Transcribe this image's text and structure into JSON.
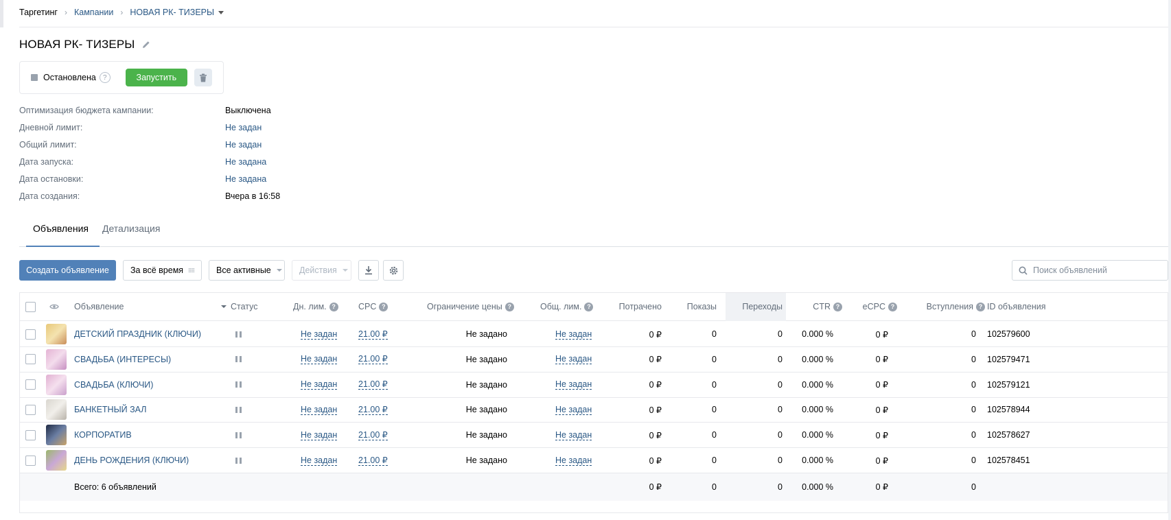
{
  "breadcrumb": {
    "items": [
      "Таргетинг",
      "Кампании",
      "НОВАЯ РК- ТИЗЕРЫ"
    ],
    "separator": "›"
  },
  "campaign": {
    "title": "НОВАЯ РК- ТИЗЕРЫ",
    "status": "Остановлена",
    "help": "?",
    "start_label": "Запустить"
  },
  "info": [
    {
      "label": "Оптимизация бюджета кампании:",
      "value": "Выключена",
      "link": false
    },
    {
      "label": "Дневной лимит:",
      "value": "Не задан",
      "link": true
    },
    {
      "label": "Общий лимит:",
      "value": "Не задан",
      "link": true
    },
    {
      "label": "Дата запуска:",
      "value": "Не задана",
      "link": true
    },
    {
      "label": "Дата остановки:",
      "value": "Не задана",
      "link": true
    },
    {
      "label": "Дата создания:",
      "value": "Вчера в 16:58",
      "link": false
    }
  ],
  "tabs": [
    {
      "label": "Объявления",
      "active": true
    },
    {
      "label": "Детализация",
      "active": false
    }
  ],
  "toolbar": {
    "create_label": "Создать объявление",
    "period_label": "За всё время",
    "filter_label": "Все активные",
    "actions_label": "Действия",
    "search_placeholder": "Поиск объявлений"
  },
  "table": {
    "headers": {
      "ad": "Объявление",
      "status": "Статус",
      "day_limit": "Дн. лим.",
      "cpc": "CPC",
      "price_limit": "Ограничение цены",
      "total_limit": "Общ. лим.",
      "spent": "Потрачено",
      "shows": "Показы",
      "clicks": "Переходы",
      "ctr": "CTR",
      "ecpc": "eCPC",
      "joins": "Вступления",
      "id": "ID объявления",
      "help": "?"
    },
    "rows": [
      {
        "name": "ДЕТСКИЙ ПРАЗДНИК (КЛЮЧИ)",
        "day_limit": "Не задан",
        "cpc": "21.00 ₽",
        "price_limit": "Не задано",
        "total_limit": "Не задан",
        "spent": "0 ₽",
        "shows": "0",
        "clicks": "0",
        "ctr": "0.000 %",
        "ecpc": "0 ₽",
        "joins": "0",
        "id": "102579600",
        "thumb_colors": [
          "#e8c87a",
          "#f4e3b0",
          "#c98e5a"
        ]
      },
      {
        "name": "СВАДЬБА (ИНТЕРЕСЫ)",
        "day_limit": "Не задан",
        "cpc": "21.00 ₽",
        "price_limit": "Не задано",
        "total_limit": "Не задан",
        "spent": "0 ₽",
        "shows": "0",
        "clicks": "0",
        "ctr": "0.000 %",
        "ecpc": "0 ₽",
        "joins": "0",
        "id": "102579471",
        "thumb_colors": [
          "#e4b3d4",
          "#f3dcec",
          "#c790c2"
        ]
      },
      {
        "name": "СВАДЬБА (КЛЮЧИ)",
        "day_limit": "Не задан",
        "cpc": "21.00 ₽",
        "price_limit": "Не задано",
        "total_limit": "Не задан",
        "spent": "0 ₽",
        "shows": "0",
        "clicks": "0",
        "ctr": "0.000 %",
        "ecpc": "0 ₽",
        "joins": "0",
        "id": "102579121",
        "thumb_colors": [
          "#e1b0d2",
          "#f5e0ee",
          "#caa0cc"
        ]
      },
      {
        "name": "БАНКЕТНЫЙ ЗАЛ",
        "day_limit": "Не задан",
        "cpc": "21.00 ₽",
        "price_limit": "Не задано",
        "total_limit": "Не задан",
        "spent": "0 ₽",
        "shows": "0",
        "clicks": "0",
        "ctr": "0.000 %",
        "ecpc": "0 ₽",
        "joins": "0",
        "id": "102578944",
        "thumb_colors": [
          "#d9d6cf",
          "#f1efea",
          "#b9b3aa"
        ]
      },
      {
        "name": "КОРПОРАТИВ",
        "day_limit": "Не задан",
        "cpc": "21.00 ₽",
        "price_limit": "Не задано",
        "total_limit": "Не задан",
        "spent": "0 ₽",
        "shows": "0",
        "clicks": "0",
        "ctr": "0.000 %",
        "ecpc": "0 ₽",
        "joins": "0",
        "id": "102578627",
        "thumb_colors": [
          "#1f2a44",
          "#6b7ea3",
          "#c9a46a"
        ]
      },
      {
        "name": "ДЕНЬ РОЖДЕНИЯ (КЛЮЧИ)",
        "day_limit": "Не задан",
        "cpc": "21.00 ₽",
        "price_limit": "Не задано",
        "total_limit": "Не задан",
        "spent": "0 ₽",
        "shows": "0",
        "clicks": "0",
        "ctr": "0.000 %",
        "ecpc": "0 ₽",
        "joins": "0",
        "id": "102578451",
        "thumb_colors": [
          "#9bb86a",
          "#c9a8d6",
          "#e6d78a"
        ]
      }
    ],
    "total": {
      "label": "Всего: 6 объявлений",
      "spent": "0 ₽",
      "shows": "0",
      "clicks": "0",
      "ctr": "0.000 %",
      "ecpc": "0 ₽",
      "joins": "0"
    }
  },
  "colors": {
    "accent": "#5181b8",
    "success": "#4bb34b",
    "link": "#2a5885",
    "muted": "#626d7a"
  }
}
